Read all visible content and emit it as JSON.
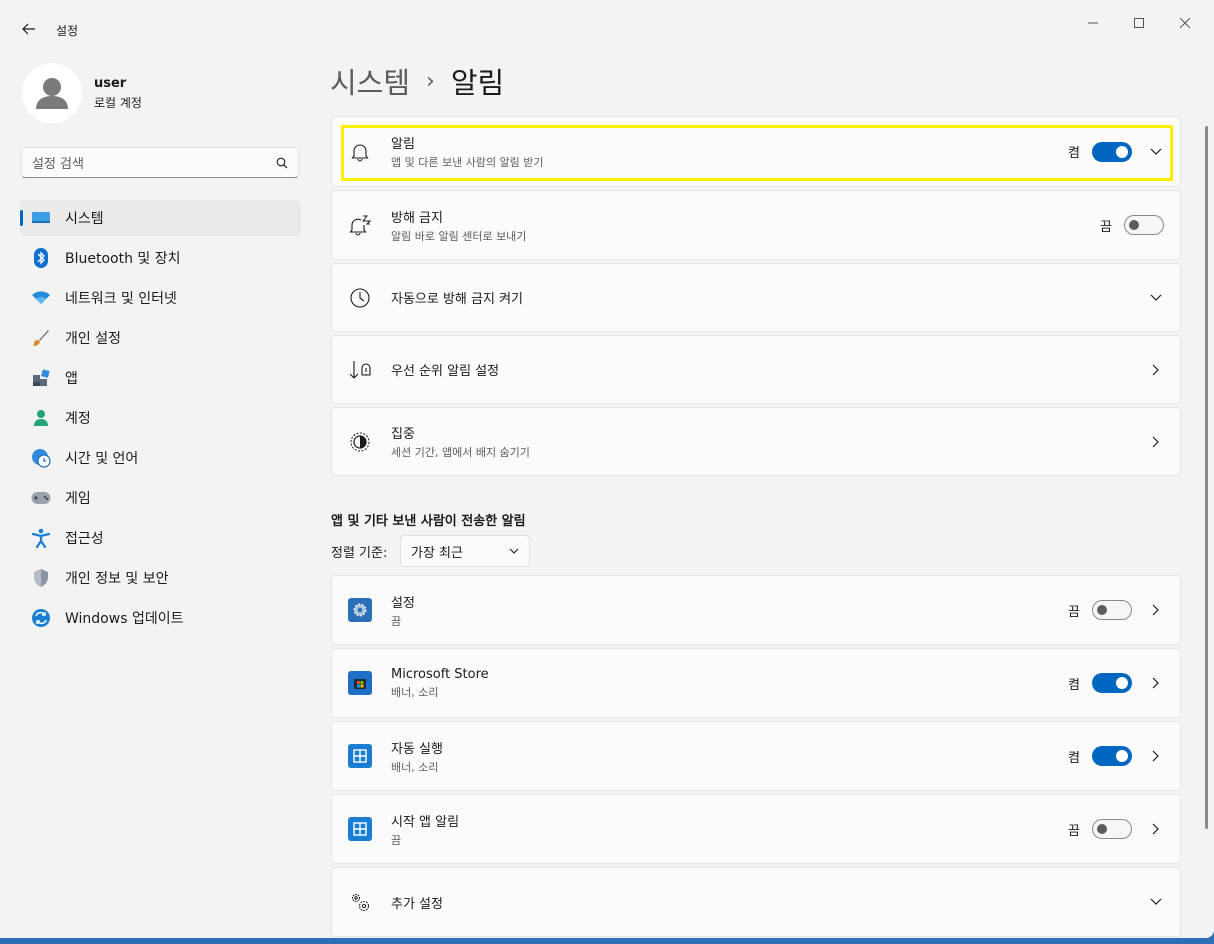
{
  "window": {
    "title": "설정"
  },
  "profile": {
    "name": "user",
    "subtitle": "로컬 계정"
  },
  "search": {
    "placeholder": "설정 검색"
  },
  "nav": [
    {
      "label": "시스템",
      "icon": "system-icon",
      "active": true
    },
    {
      "label": "Bluetooth 및 장치",
      "icon": "bluetooth-icon"
    },
    {
      "label": "네트워크 및 인터넷",
      "icon": "wifi-icon"
    },
    {
      "label": "개인 설정",
      "icon": "brush-icon"
    },
    {
      "label": "앱",
      "icon": "apps-icon"
    },
    {
      "label": "계정",
      "icon": "account-icon"
    },
    {
      "label": "시간 및 언어",
      "icon": "globe-clock-icon"
    },
    {
      "label": "게임",
      "icon": "gamepad-icon"
    },
    {
      "label": "접근성",
      "icon": "accessibility-icon"
    },
    {
      "label": "개인 정보 및 보안",
      "icon": "shield-icon"
    },
    {
      "label": "Windows 업데이트",
      "icon": "update-icon"
    }
  ],
  "header": {
    "parent": "시스템",
    "separator": "›",
    "current": "알림"
  },
  "cards": {
    "notifications": {
      "title": "알림",
      "subtitle": "앱 및 다른 보낸 사람의 알림 받기",
      "state": "켬",
      "icon": "bell-icon"
    },
    "dnd": {
      "title": "방해 금지",
      "subtitle": "알림 바로 알림 센터로 보내기",
      "state": "끔",
      "icon": "bell-zz-icon"
    },
    "auto_dnd": {
      "title": "자동으로 방해 금지 켜기",
      "icon": "clock-icon"
    },
    "priority": {
      "title": "우선 순위 알림 설정",
      "icon": "priority-sort-icon"
    },
    "focus": {
      "title": "집중",
      "subtitle": "세션 기간, 앱에서 배지 숨기기",
      "icon": "focus-icon"
    }
  },
  "senders": {
    "section_title": "앱 및 기타 보낸 사람이 전송한 알림",
    "sort_label": "정렬 기준:",
    "sort_value": "가장 최근",
    "apps": [
      {
        "title": "설정",
        "subtitle": "끔",
        "state": "끔",
        "on": false,
        "icon": "settings-app-icon"
      },
      {
        "title": "Microsoft Store",
        "subtitle": "배너, 소리",
        "state": "켬",
        "on": true,
        "icon": "store-app-icon"
      },
      {
        "title": "자동 실행",
        "subtitle": "배너, 소리",
        "state": "켬",
        "on": true,
        "icon": "autoplay-app-icon"
      },
      {
        "title": "시작 앱 알림",
        "subtitle": "끔",
        "state": "끔",
        "on": false,
        "icon": "startup-app-icon"
      }
    ],
    "more": {
      "title": "추가 설정",
      "icon": "gears-icon"
    }
  },
  "colors": {
    "accent": "#0067c0",
    "highlight": "#ffee00"
  }
}
